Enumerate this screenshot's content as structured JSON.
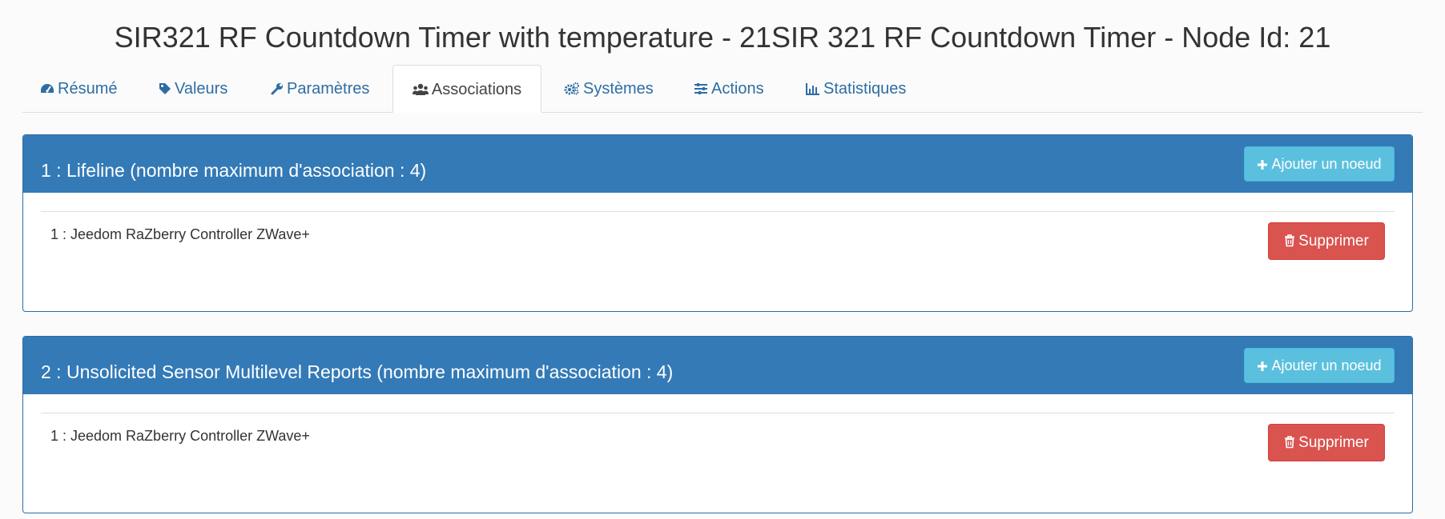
{
  "page_title": "SIR321 RF Countdown Timer with temperature - 21SIR 321 RF Countdown Timer - Node Id: 21",
  "tabs": [
    {
      "label": "Résumé",
      "icon": "dashboard-icon"
    },
    {
      "label": "Valeurs",
      "icon": "tag-icon"
    },
    {
      "label": "Paramètres",
      "icon": "wrench-icon"
    },
    {
      "label": "Associations",
      "icon": "users-icon",
      "active": true
    },
    {
      "label": "Systèmes",
      "icon": "cogs-icon"
    },
    {
      "label": "Actions",
      "icon": "sliders-icon"
    },
    {
      "label": "Statistiques",
      "icon": "bar-chart-icon"
    }
  ],
  "groups": [
    {
      "title": "1 : Lifeline (nombre maximum d'association : 4)",
      "add_label": "Ajouter un noeud",
      "nodes": [
        {
          "label": "1 : Jeedom RaZberry Controller ZWave+",
          "delete_label": "Supprimer"
        }
      ]
    },
    {
      "title": "2 : Unsolicited Sensor Multilevel Reports (nombre maximum d'association : 4)",
      "add_label": "Ajouter un noeud",
      "nodes": [
        {
          "label": "1 : Jeedom RaZberry Controller ZWave+",
          "delete_label": "Supprimer"
        }
      ]
    }
  ],
  "colors": {
    "primary": "#337ab7",
    "info": "#5bc0de",
    "danger": "#d9534f",
    "link": "#2e6da4"
  }
}
